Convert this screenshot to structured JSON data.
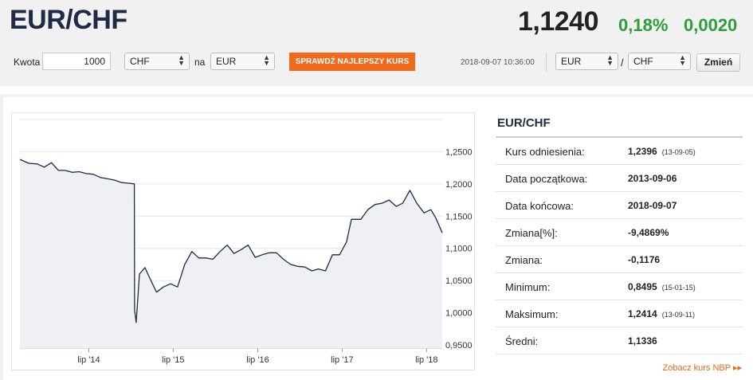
{
  "header": {
    "pair": "EUR/CHF",
    "rate": "1,1240",
    "change_pct": "0,18%",
    "change_abs": "0,0020"
  },
  "converter": {
    "amount_label": "Kwota",
    "amount_value": "1000",
    "from_currency": "CHF",
    "to_label": "na",
    "to_currency": "EUR",
    "check_button": "SPRAWDŹ NAJLEPSZY KURS",
    "timestamp": "2018-09-07 10:36:00",
    "pair_base": "EUR",
    "pair_sep": "/",
    "pair_quote": "CHF",
    "change_button": "Zmień"
  },
  "colors": {
    "orange": "#f26b1d",
    "green": "#2e9e3a",
    "line": "#1f2a44",
    "area": "#eef0f3"
  },
  "stats": {
    "title": "EUR/CHF",
    "rows": [
      {
        "label": "Kurs odniesienia:",
        "value": "1,2396",
        "date": "(13-09-05)"
      },
      {
        "label": "Data początkowa:",
        "value": "2013-09-06",
        "date": ""
      },
      {
        "label": "Data końcowa:",
        "value": "2018-09-07",
        "date": ""
      },
      {
        "label": "Zmiana[%]:",
        "value": "-9,4869%",
        "date": ""
      },
      {
        "label": "Zmiana:",
        "value": "-0,1176",
        "date": ""
      },
      {
        "label": "Minimum:",
        "value": "0,8495",
        "date": "(15-01-15)"
      },
      {
        "label": "Maksimum:",
        "value": "1,2414",
        "date": "(13-09-11)"
      },
      {
        "label": "Średni:",
        "value": "1,1336",
        "date": ""
      }
    ],
    "nbp_link": "Zobacz kurs NBP ▸▸"
  },
  "chart_data": {
    "type": "area",
    "x_tick_labels": [
      "lip '14",
      "lip '15",
      "lip '16",
      "lip '17",
      "lip '18"
    ],
    "y_tick_labels": [
      "1,2500",
      "1,2000",
      "1,1500",
      "1,1000",
      "1,0500",
      "1,0000",
      "0,9500"
    ],
    "y_ticks": [
      1.25,
      1.2,
      1.15,
      1.1,
      1.05,
      1.0,
      0.95
    ],
    "ylim": [
      0.945,
      1.3
    ],
    "xlim": [
      "2013-09-06",
      "2018-09-07"
    ],
    "grid": true,
    "series": [
      {
        "values": [
          [
            "2013-09-06",
            1.238
          ],
          [
            "2013-10-15",
            1.232
          ],
          [
            "2013-11-20",
            1.231
          ],
          [
            "2013-12-20",
            1.226
          ],
          [
            "2014-01-20",
            1.233
          ],
          [
            "2014-02-20",
            1.221
          ],
          [
            "2014-03-20",
            1.221
          ],
          [
            "2014-04-20",
            1.218
          ],
          [
            "2014-05-20",
            1.219
          ],
          [
            "2014-06-20",
            1.216
          ],
          [
            "2014-07-20",
            1.215
          ],
          [
            "2014-08-20",
            1.21
          ],
          [
            "2014-09-20",
            1.208
          ],
          [
            "2014-10-20",
            1.206
          ],
          [
            "2014-11-20",
            1.202
          ],
          [
            "2014-12-20",
            1.201
          ],
          [
            "2015-01-14",
            1.2
          ],
          [
            "2015-01-15",
            1.004
          ],
          [
            "2015-01-22",
            0.985
          ],
          [
            "2015-02-05",
            1.06
          ],
          [
            "2015-03-01",
            1.07
          ],
          [
            "2015-03-20",
            1.055
          ],
          [
            "2015-04-20",
            1.032
          ],
          [
            "2015-05-20",
            1.04
          ],
          [
            "2015-06-20",
            1.045
          ],
          [
            "2015-07-20",
            1.04
          ],
          [
            "2015-08-20",
            1.075
          ],
          [
            "2015-09-20",
            1.095
          ],
          [
            "2015-10-20",
            1.085
          ],
          [
            "2015-11-20",
            1.085
          ],
          [
            "2015-12-20",
            1.083
          ],
          [
            "2016-01-20",
            1.095
          ],
          [
            "2016-02-20",
            1.105
          ],
          [
            "2016-03-20",
            1.092
          ],
          [
            "2016-04-20",
            1.098
          ],
          [
            "2016-05-20",
            1.105
          ],
          [
            "2016-06-20",
            1.086
          ],
          [
            "2016-07-20",
            1.09
          ],
          [
            "2016-08-20",
            1.093
          ],
          [
            "2016-09-20",
            1.093
          ],
          [
            "2016-10-20",
            1.083
          ],
          [
            "2016-11-20",
            1.075
          ],
          [
            "2016-12-20",
            1.072
          ],
          [
            "2017-01-20",
            1.071
          ],
          [
            "2017-02-20",
            1.065
          ],
          [
            "2017-03-20",
            1.068
          ],
          [
            "2017-04-20",
            1.065
          ],
          [
            "2017-05-20",
            1.09
          ],
          [
            "2017-06-20",
            1.09
          ],
          [
            "2017-07-20",
            1.11
          ],
          [
            "2017-08-10",
            1.145
          ],
          [
            "2017-09-20",
            1.145
          ],
          [
            "2017-10-20",
            1.16
          ],
          [
            "2017-11-20",
            1.168
          ],
          [
            "2017-12-20",
            1.17
          ],
          [
            "2018-01-20",
            1.175
          ],
          [
            "2018-02-20",
            1.165
          ],
          [
            "2018-03-20",
            1.17
          ],
          [
            "2018-04-20",
            1.19
          ],
          [
            "2018-05-20",
            1.17
          ],
          [
            "2018-06-20",
            1.155
          ],
          [
            "2018-07-20",
            1.16
          ],
          [
            "2018-08-10",
            1.147
          ],
          [
            "2018-08-25",
            1.135
          ],
          [
            "2018-09-07",
            1.124
          ]
        ]
      }
    ]
  }
}
